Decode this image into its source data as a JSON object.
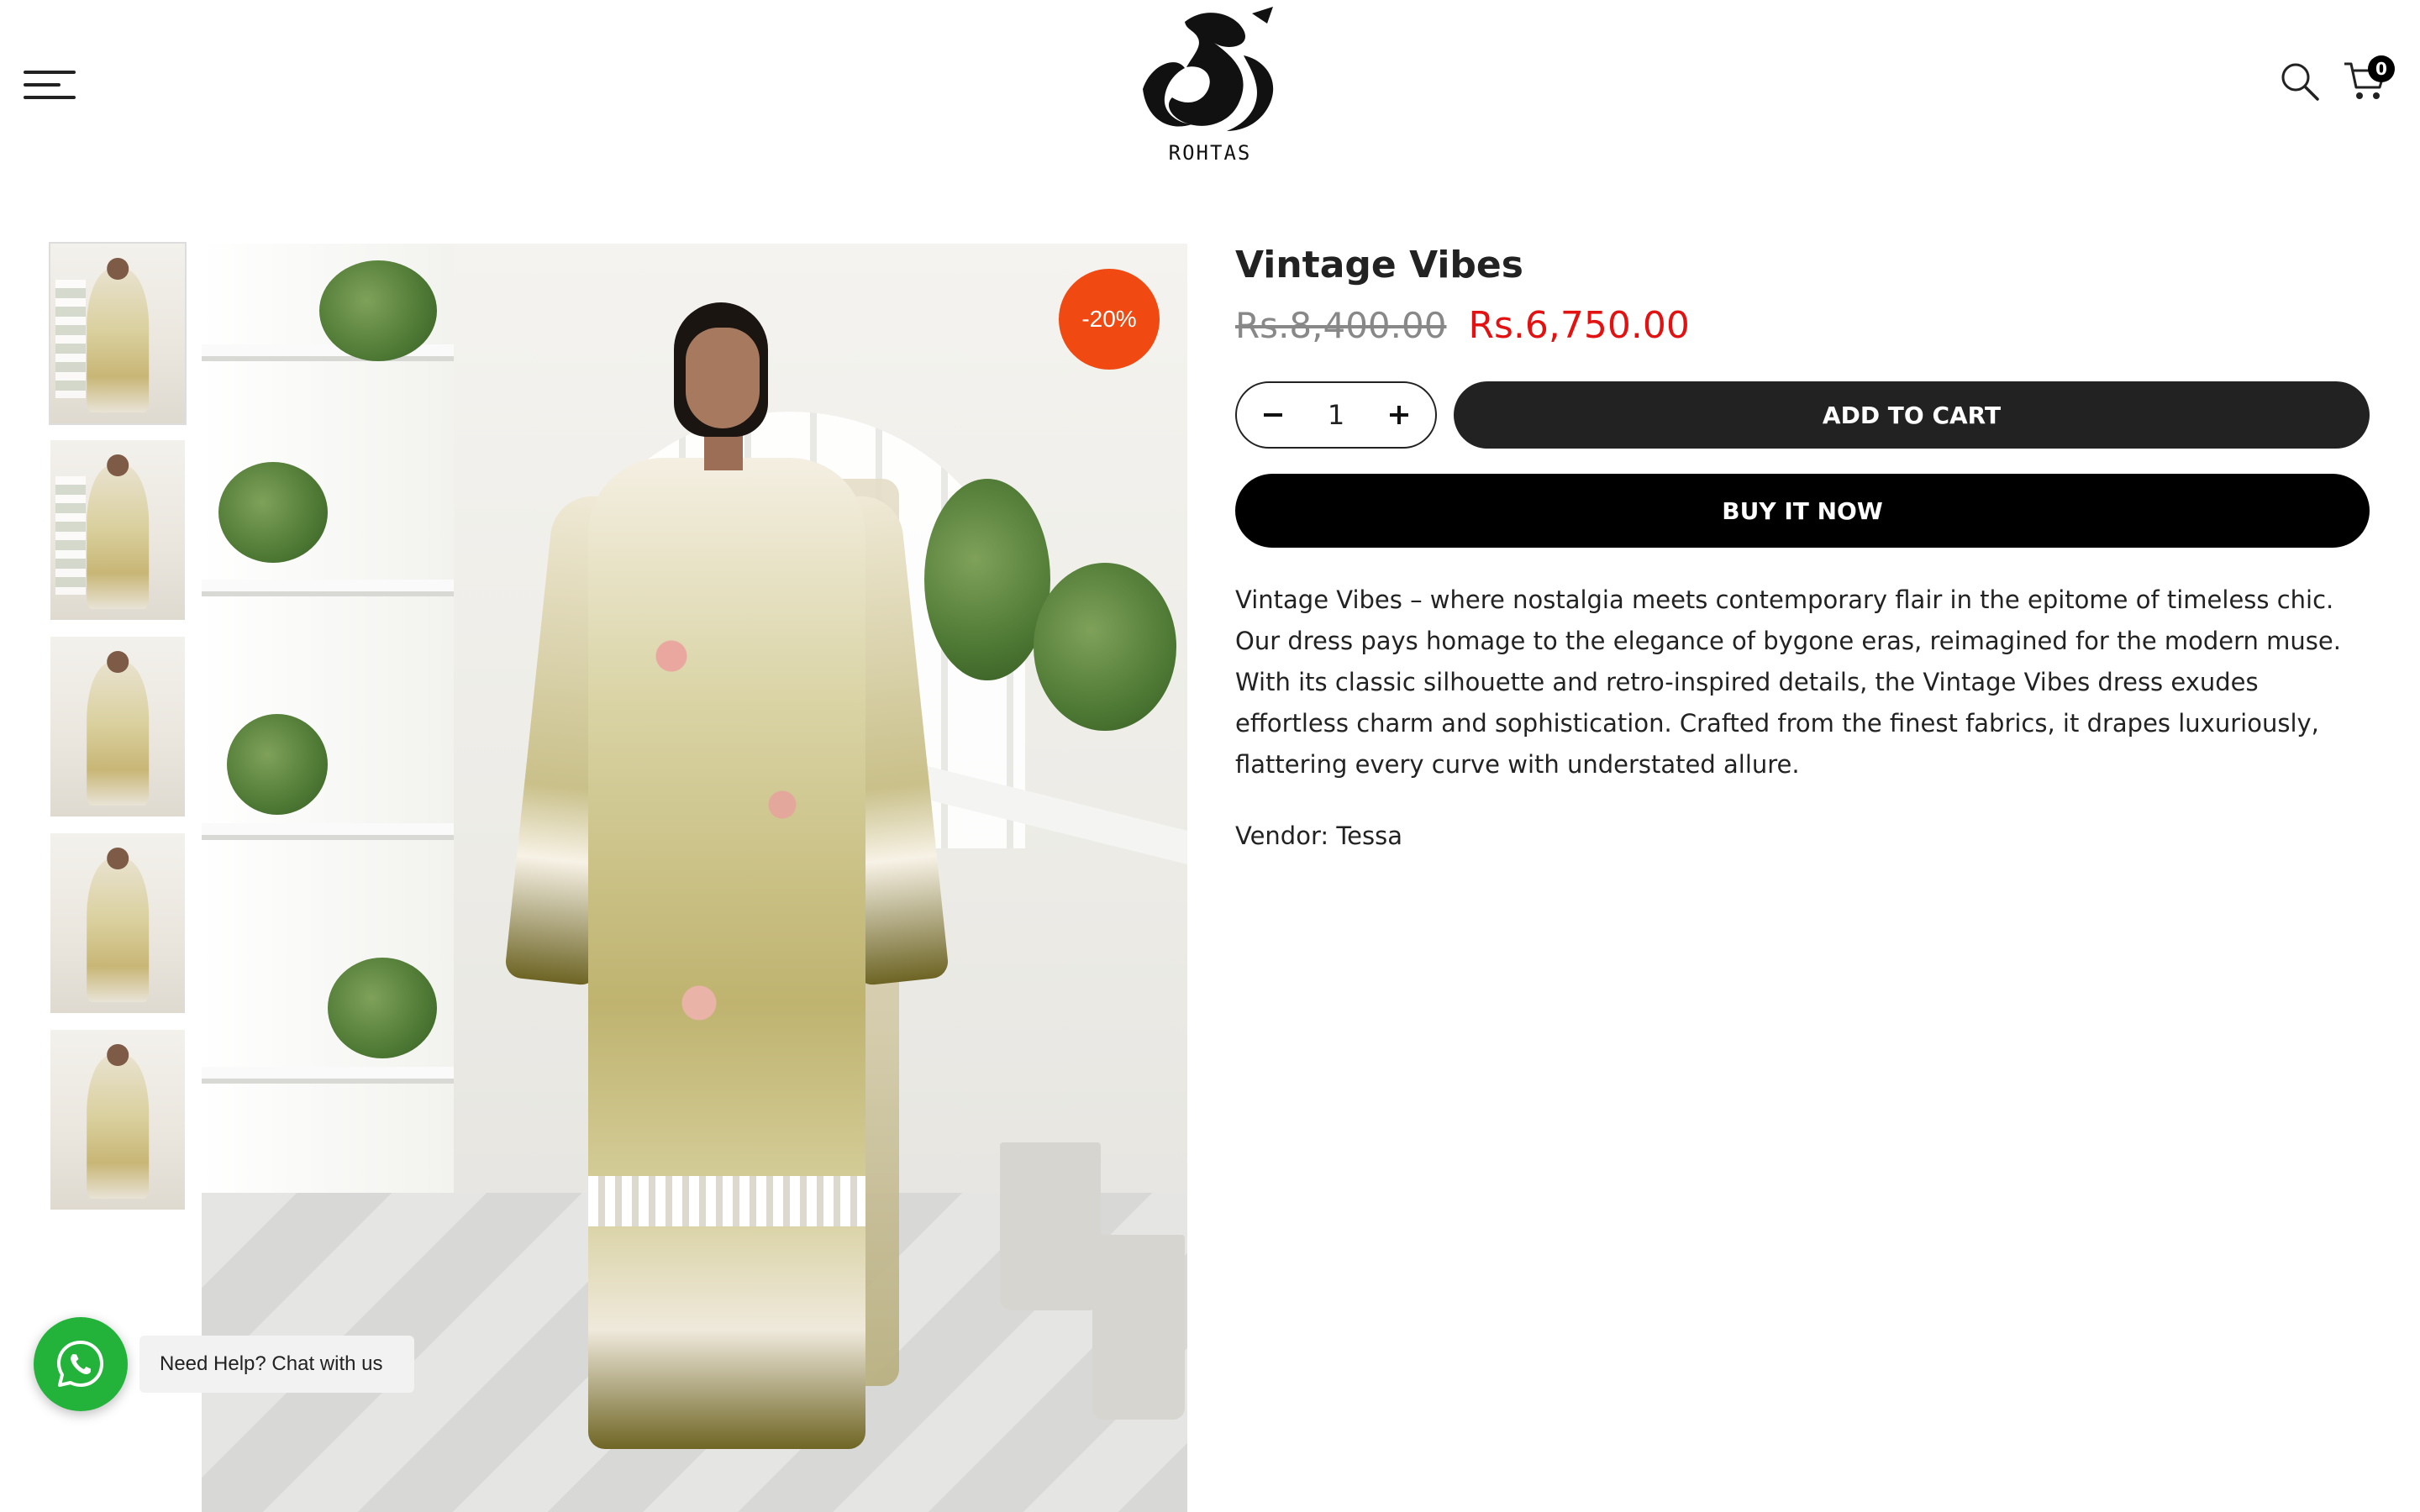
{
  "header": {
    "logo_text": "ROHTAS",
    "cart_count": "0",
    "icons": [
      "menu-icon",
      "search-icon",
      "cart-icon"
    ]
  },
  "gallery": {
    "discount_badge": "-20%",
    "thumbnail_count": 5
  },
  "product": {
    "title": "Vintage Vibes",
    "price_original": "Rs.8,400.00",
    "price_sale": "Rs.6,750.00",
    "quantity": "1",
    "add_to_cart_label": "ADD TO CART",
    "buy_now_label": "BUY IT NOW",
    "description": "Vintage Vibes – where nostalgia meets contemporary flair in the epitome of timeless chic. Our dress pays homage to the elegance of bygone eras, reimagined for the modern muse. With its classic silhouette and retro-inspired details, the Vintage Vibes dress exudes effortless charm and sophistication. Crafted from the finest fabrics, it drapes luxuriously, flattering every curve with understated allure.",
    "vendor_label": "Vendor: ",
    "vendor_value": "Tessa"
  },
  "chat": {
    "label": "Need Help? Chat with us"
  },
  "colors": {
    "sale_price": "#e31212",
    "badge": "#f04a12",
    "whatsapp": "#23b33a",
    "button_dark": "#222222"
  }
}
